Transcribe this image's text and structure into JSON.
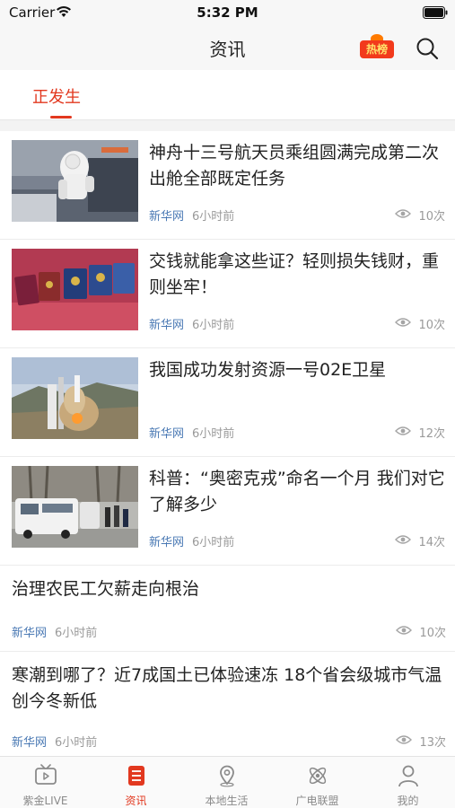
{
  "status_bar": {
    "carrier": "Carrier",
    "time": "5:32 PM"
  },
  "nav": {
    "title": "资讯",
    "hot_badge": "热榜",
    "search_icon": "search-icon"
  },
  "tabs": [
    {
      "label": "正发生",
      "active": true
    }
  ],
  "news": [
    {
      "headline": "神舟十三号航天员乘组圆满完成第二次出舱全部既定任务",
      "source": "新华网",
      "ago": "6小时前",
      "views": "10次",
      "has_image": true
    },
    {
      "headline": "交钱就能拿这些证？轻则损失钱财，重则坐牢！",
      "source": "新华网",
      "ago": "6小时前",
      "views": "10次",
      "has_image": true
    },
    {
      "headline": "我国成功发射资源一号02E卫星",
      "source": "新华网",
      "ago": "6小时前",
      "views": "12次",
      "has_image": true
    },
    {
      "headline": "科普：“奥密克戎”命名一个月 我们对它了解多少",
      "source": "新华网",
      "ago": "6小时前",
      "views": "14次",
      "has_image": true
    },
    {
      "headline": "治理农民工欠薪走向根治",
      "source": "新华网",
      "ago": "6小时前",
      "views": "10次",
      "has_image": false
    },
    {
      "headline": "寒潮到哪了？近7成国土已体验速冻 18个省会级城市气温创今冬新低",
      "source": "新华网",
      "ago": "6小时前",
      "views": "13次",
      "has_image": false
    }
  ],
  "tab_bar": [
    {
      "label": "紫金LIVE",
      "icon": "tv-icon",
      "active": false
    },
    {
      "label": "资讯",
      "icon": "news-list-icon",
      "active": true
    },
    {
      "label": "本地生活",
      "icon": "location-pin-icon",
      "active": false
    },
    {
      "label": "广电联盟",
      "icon": "atom-icon",
      "active": false
    },
    {
      "label": "我的",
      "icon": "person-icon",
      "active": false
    }
  ],
  "colors": {
    "accent": "#e2381f",
    "source_blue": "#4a79b4",
    "muted": "#9a9a9a"
  }
}
